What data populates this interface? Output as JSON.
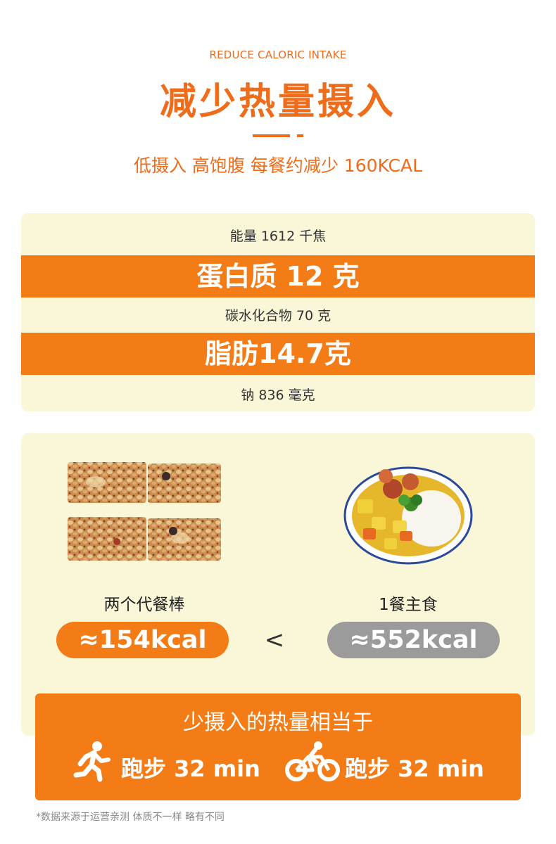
{
  "header": {
    "eyebrow": "REDUCE CALORIC INTAKE",
    "title": "减少热量摄入",
    "subtitle": "低摄入 高饱腹 每餐约减少 160KCAL"
  },
  "nutrition": {
    "energy": "能量 1612 千焦",
    "protein": "蛋白质  12  克",
    "carbs": "碳水化合物  70  克",
    "fat": "脂肪14.7克",
    "sodium": "钠 836 毫克"
  },
  "compare": {
    "left_label": "两个代餐棒",
    "left_value": "≈154kcal",
    "symbol": "<",
    "right_label": "1餐主食",
    "right_value": "≈552kcal"
  },
  "burn": {
    "title": "少摄入的热量相当于",
    "item1": "跑步  32 min",
    "item2": "跑步  32 min",
    "icon1": "running-person-icon",
    "icon2": "bicycle-icon"
  },
  "footnote": "*数据来源于运营亲测  体质不一样 略有不同",
  "colors": {
    "accent": "#f47c16",
    "title_orange": "#ee6c1a",
    "card_bg": "#f9f7d7",
    "gray_pill": "#9b9b9b"
  }
}
